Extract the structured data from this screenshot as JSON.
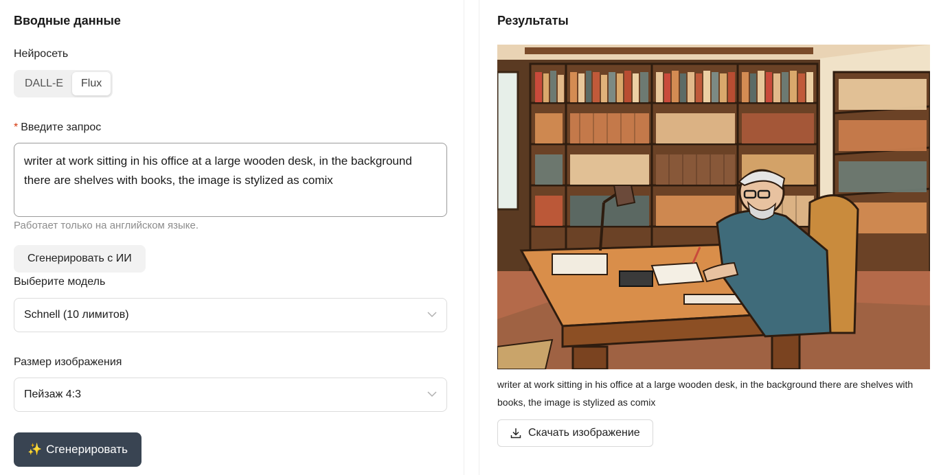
{
  "input_panel": {
    "title": "Вводные данные",
    "network_label": "Нейросеть",
    "networks": [
      "DALL-E",
      "Flux"
    ],
    "selected_network": "Flux",
    "prompt_label": "Введите запрос",
    "prompt_required_mark": "*",
    "prompt_value": "writer at work sitting in his office at a large wooden desk, in the background there are shelves with books, the image is stylized as comix",
    "prompt_hint": "Работает только на английском языке.",
    "ai_generate_button": "Сгенерировать с ИИ",
    "model_label": "Выберите модель",
    "model_value": "Schnell (10 лимитов)",
    "size_label": "Размер изображения",
    "size_value": "Пейзаж 4:3",
    "generate_icon": "✨",
    "generate_button": "Сгенерировать"
  },
  "results_panel": {
    "title": "Результаты",
    "image_icon": "comic-illustration-writer-at-desk",
    "caption": "writer at work sitting in his office at a large wooden desk, in the background there are shelves with books, the image is stylized as comix",
    "download_icon": "download-icon",
    "download_button": "Скачать изображение"
  },
  "colors": {
    "primary_button": "#394452",
    "required_mark": "#d4380d"
  }
}
